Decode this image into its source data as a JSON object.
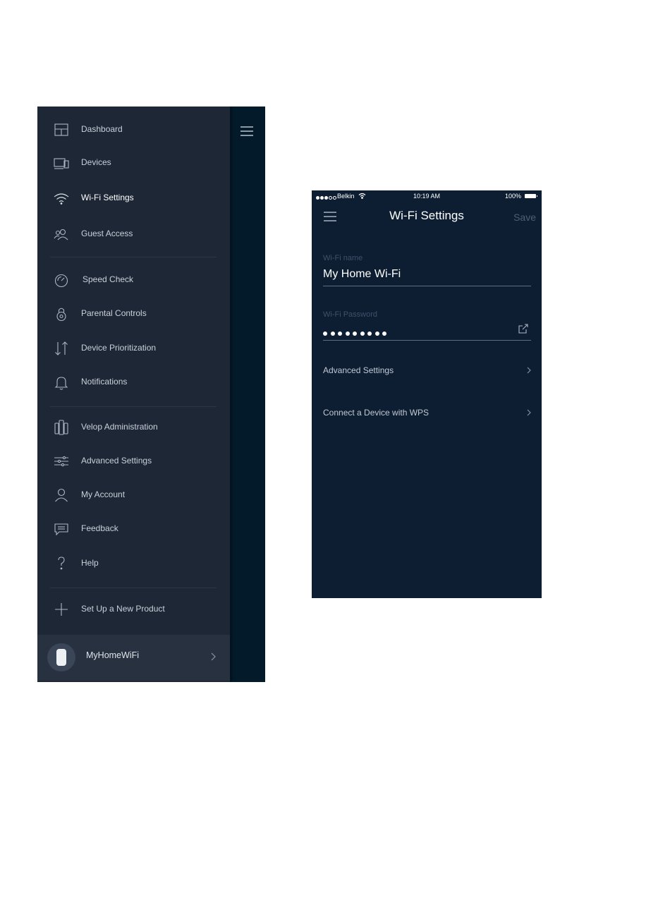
{
  "menu": {
    "items": [
      {
        "label": "Dashboard",
        "icon": "dashboard-icon"
      },
      {
        "label": "Devices",
        "icon": "devices-icon"
      },
      {
        "label": "Wi-Fi Settings",
        "icon": "wifi-icon",
        "active": true
      },
      {
        "label": "Guest Access",
        "icon": "guest-access-icon"
      },
      {
        "label": "Speed Check",
        "icon": "speedometer-icon"
      },
      {
        "label": "Parental Controls",
        "icon": "lock-icon"
      },
      {
        "label": "Device Prioritization",
        "icon": "arrows-updown-icon"
      },
      {
        "label": "Notifications",
        "icon": "bell-icon"
      },
      {
        "label": "Velop Administration",
        "icon": "velop-nodes-icon"
      },
      {
        "label": "Advanced Settings",
        "icon": "sliders-icon"
      },
      {
        "label": "My Account",
        "icon": "person-icon"
      },
      {
        "label": "Feedback",
        "icon": "chat-bubble-icon"
      },
      {
        "label": "Help",
        "icon": "question-icon"
      },
      {
        "label": "Set Up a New Product",
        "icon": "plus-icon"
      }
    ],
    "network": {
      "name": "MyHomeWiFi"
    }
  },
  "phone": {
    "status": {
      "carrier": "Belkin",
      "time": "10:19 AM",
      "battery": "100%"
    },
    "title": "Wi-Fi Settings",
    "save_label": "Save",
    "wifi_name_label": "Wi-Fi name",
    "wifi_name_value": "My Home Wi-Fi",
    "wifi_password_label": "Wi-Fi Password",
    "password_mask_length": 9,
    "links": [
      {
        "label": "Advanced Settings"
      },
      {
        "label": "Connect a Device with WPS"
      }
    ]
  },
  "colors": {
    "drawer_bg": "#1e2736",
    "screen_bg": "#0d1e33",
    "side_strip": "#031a2b",
    "text": "#c9d0da",
    "muted_label": "#3f5068"
  }
}
